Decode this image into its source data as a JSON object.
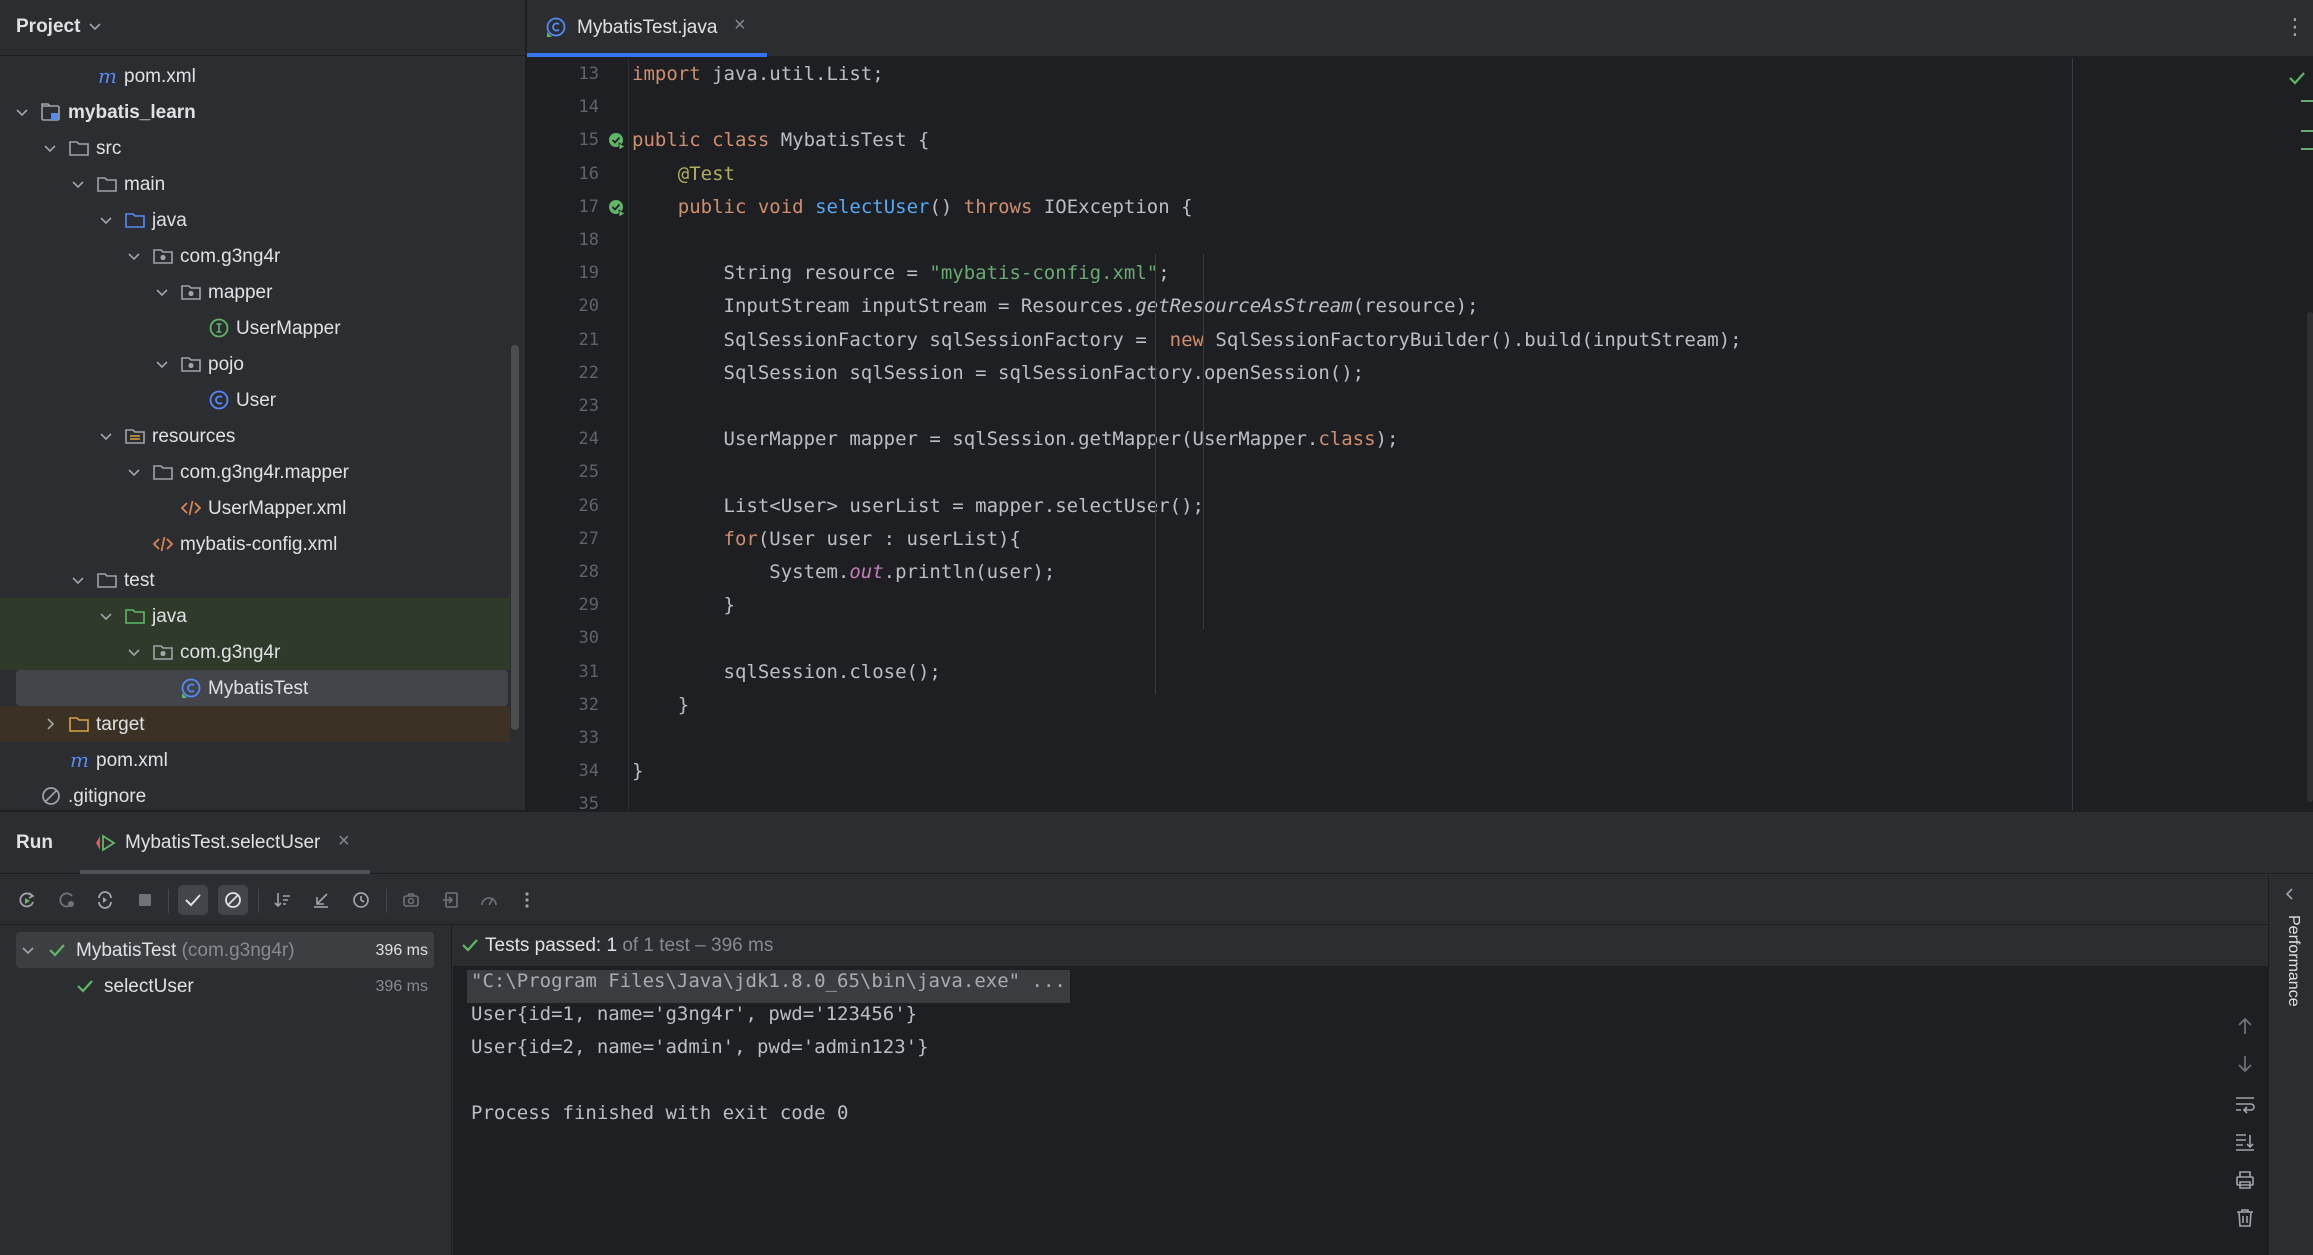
{
  "project": {
    "title": "Project",
    "tree": [
      {
        "label": "pom.xml",
        "icon": "maven-icon",
        "depth": 3,
        "expanded": null
      },
      {
        "label": "mybatis_learn",
        "icon": "module-icon",
        "depth": 1,
        "expanded": true,
        "bold": true
      },
      {
        "label": "src",
        "icon": "folder-icon",
        "depth": 2,
        "expanded": true
      },
      {
        "label": "main",
        "icon": "folder-icon",
        "depth": 3,
        "expanded": true
      },
      {
        "label": "java",
        "icon": "source-folder-icon",
        "depth": 4,
        "expanded": true
      },
      {
        "label": "com.g3ng4r",
        "icon": "package-icon",
        "depth": 5,
        "expanded": true
      },
      {
        "label": "mapper",
        "icon": "package-icon",
        "depth": 6,
        "expanded": true
      },
      {
        "label": "UserMapper",
        "icon": "interface-icon",
        "depth": 7,
        "expanded": null
      },
      {
        "label": "pojo",
        "icon": "package-icon",
        "depth": 6,
        "expanded": true
      },
      {
        "label": "User",
        "icon": "class-icon",
        "depth": 7,
        "expanded": null
      },
      {
        "label": "resources",
        "icon": "resources-folder-icon",
        "depth": 4,
        "expanded": true
      },
      {
        "label": "com.g3ng4r.mapper",
        "icon": "folder-icon",
        "depth": 5,
        "expanded": true
      },
      {
        "label": "UserMapper.xml",
        "icon": "xml-icon",
        "depth": 6,
        "expanded": null
      },
      {
        "label": "mybatis-config.xml",
        "icon": "xml-icon",
        "depth": 5,
        "expanded": null
      },
      {
        "label": "test",
        "icon": "folder-icon",
        "depth": 3,
        "expanded": true
      },
      {
        "label": "java",
        "icon": "test-folder-icon",
        "depth": 4,
        "expanded": true
      },
      {
        "label": "com.g3ng4r",
        "icon": "package-icon",
        "depth": 5,
        "expanded": true
      },
      {
        "label": "MybatisTest",
        "icon": "test-class-icon",
        "depth": 6,
        "expanded": null,
        "selected": true
      },
      {
        "label": "target",
        "icon": "excluded-folder-icon",
        "depth": 2,
        "expanded": false
      },
      {
        "label": "pom.xml",
        "icon": "maven-icon",
        "depth": 2,
        "expanded": null
      },
      {
        "label": ".gitignore",
        "icon": "ignored-icon",
        "depth": 1,
        "expanded": null
      }
    ]
  },
  "editor": {
    "tab_label": "MybatisTest.java",
    "tab_close": "×",
    "more": "⋮",
    "lines": [
      {
        "n": "13",
        "html": "<span class=\"kw\">import</span> java.util.List;"
      },
      {
        "n": "14",
        "html": ""
      },
      {
        "n": "15",
        "html": "<span class=\"kw\">public class</span> MybatisTest {",
        "run": true
      },
      {
        "n": "16",
        "html": "    <span class=\"ann\">@Test</span>"
      },
      {
        "n": "17",
        "html": "    <span class=\"kw\">public void</span> <span class=\"fn\">selectUser</span>() <span class=\"kw\">throws</span> IOException {",
        "run": true
      },
      {
        "n": "18",
        "html": ""
      },
      {
        "n": "19",
        "html": "        String resource = <span class=\"str\">\"mybatis-config.xml\"</span>;"
      },
      {
        "n": "20",
        "html": "        InputStream inputStream = Resources.<span class=\"it\">getResourceAsStream</span>(resource);"
      },
      {
        "n": "21",
        "html": "        SqlSessionFactory sqlSessionFactory =  <span class=\"kw\">new</span> SqlSessionFactoryBuilder().build(inputStream);"
      },
      {
        "n": "22",
        "html": "        SqlSession sqlSession = sqlSessionFactory.openSession();"
      },
      {
        "n": "23",
        "html": ""
      },
      {
        "n": "24",
        "html": "        UserMapper mapper = sqlSession.getMapper(UserMapper.<span class=\"kw\">class</span>);"
      },
      {
        "n": "25",
        "html": ""
      },
      {
        "n": "26",
        "html": "        List&lt;User&gt; userList = mapper.selectUser();"
      },
      {
        "n": "27",
        "html": "        <span class=\"kw\">for</span>(User user : userList){"
      },
      {
        "n": "28",
        "html": "            System.<span class=\"stat\">out</span>.println(user);"
      },
      {
        "n": "29",
        "html": "        }"
      },
      {
        "n": "30",
        "html": ""
      },
      {
        "n": "31",
        "html": "        sqlSession.close();"
      },
      {
        "n": "32",
        "html": "    }"
      },
      {
        "n": "33",
        "html": ""
      },
      {
        "n": "34",
        "html": "}"
      },
      {
        "n": "35",
        "html": ""
      }
    ]
  },
  "run": {
    "title": "Run",
    "tab_label": "MybatisTest.selectUser",
    "tab_close": "×",
    "toolbar": [
      "rerun-icon",
      "rerun-failed-icon",
      "toggle-auto-test-icon",
      "stop-icon",
      "show-passed-icon",
      "show-ignored-icon",
      "sort-icon",
      "collapse-icon",
      "history-icon",
      "camera-icon",
      "export-icon",
      "coverage-icon",
      "more-icon"
    ],
    "tests": [
      {
        "name": "MybatisTest",
        "pkg": "(com.g3ng4r)",
        "duration": "396 ms"
      },
      {
        "name": "selectUser",
        "pkg": "",
        "duration": "396 ms"
      }
    ],
    "status": {
      "prefix": "Tests passed:",
      "count": "1",
      "suffix": "of 1 test – 396 ms"
    },
    "console": [
      "\"C:\\Program Files\\Java\\jdk1.8.0_65\\bin\\java.exe\" ...",
      "User{id=1, name='g3ng4r', pwd='123456'}",
      "User{id=2, name='admin', pwd='admin123'}",
      "",
      "Process finished with exit code 0"
    ],
    "side_panel_label": "Performance"
  },
  "colors": {
    "accent": "#3574f0",
    "success": "#5fb865",
    "keyword": "#cf8e6d",
    "string": "#6aab73",
    "function": "#56a8f5"
  }
}
